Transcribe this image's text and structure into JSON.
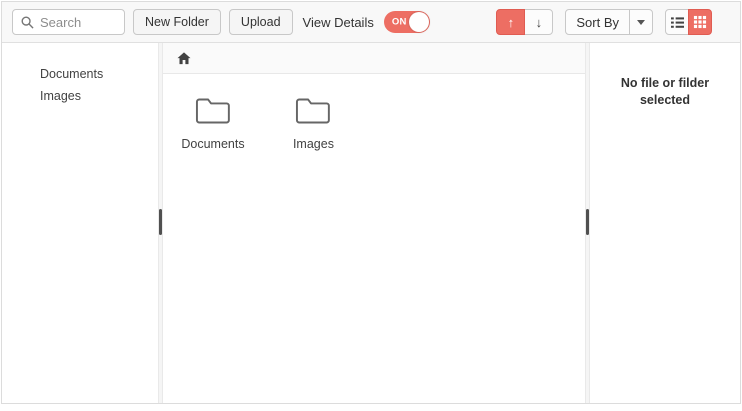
{
  "toolbar": {
    "search_placeholder": "Search",
    "new_folder_label": "New Folder",
    "upload_label": "Upload",
    "view_details_label": "View Details",
    "toggle_state": "ON",
    "sort_ascending_glyph": "↑",
    "sort_descending_glyph": "↓",
    "sort_by_label": "Sort By"
  },
  "sidebar": {
    "items": [
      {
        "label": "Documents"
      },
      {
        "label": "Images"
      }
    ]
  },
  "main": {
    "folders": [
      {
        "name": "Documents"
      },
      {
        "name": "Images"
      }
    ]
  },
  "details_panel": {
    "empty_message": "No file or filder selected"
  },
  "colors": {
    "accent": "#ed6e63",
    "toolbar_bg": "#f8f8f8",
    "border": "#e0e0e0",
    "text": "#333333"
  }
}
